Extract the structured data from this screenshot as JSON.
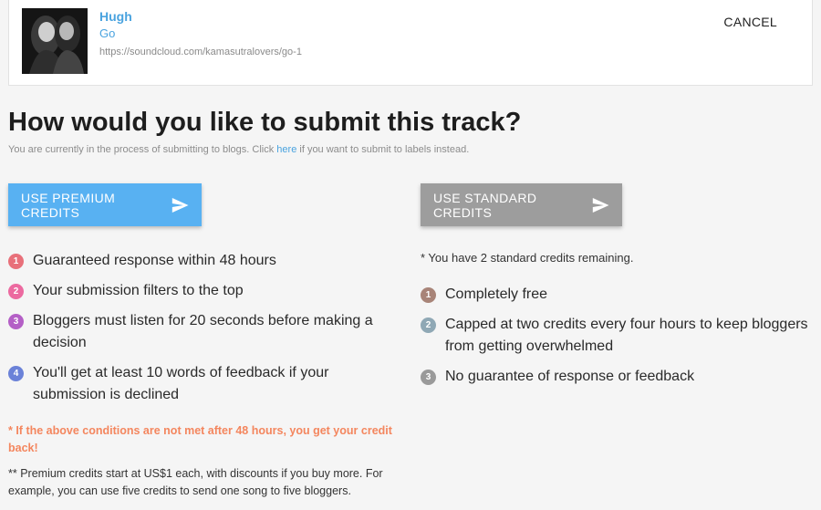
{
  "track": {
    "artist": "Hugh",
    "title": "Go",
    "url": "https://soundcloud.com/kamasutralovers/go-1",
    "cancel_label": "CANCEL"
  },
  "page": {
    "title": "How would you like to submit this track?",
    "subtitle_before": "You are currently in the process of submitting to blogs. Click ",
    "subtitle_link": "here",
    "subtitle_after": " if you want to submit to labels instead."
  },
  "premium": {
    "button_label": "USE PREMIUM CREDITS",
    "color": "#58b1f2",
    "items": [
      {
        "num": "1",
        "text": "Guaranteed response within 48 hours",
        "color": "#e8707a"
      },
      {
        "num": "2",
        "text": "Your submission filters to the top",
        "color": "#ec6aa0"
      },
      {
        "num": "3",
        "text": "Bloggers must listen for 20 seconds before making a decision",
        "color": "#b45fc6"
      },
      {
        "num": "4",
        "text": "You'll get at least 10 words of feedback if your submission is declined",
        "color": "#6b82d8"
      }
    ],
    "warning": "* If the above conditions are not met after 48 hours, you get your credit back!",
    "price_note": "** Premium credits start at US$1 each, with discounts if you buy more. For example, you can use five credits to send one song to five bloggers."
  },
  "standard": {
    "button_label": "USE STANDARD CREDITS",
    "color": "#9d9d9d",
    "remaining_note": "* You have 2 standard credits remaining.",
    "items": [
      {
        "num": "1",
        "text": "Completely free",
        "color": "#a88478"
      },
      {
        "num": "2",
        "text": "Capped at two credits every four hours to keep bloggers from getting overwhelmed",
        "color": "#8fa8b5"
      },
      {
        "num": "3",
        "text": "No guarantee of response or feedback",
        "color": "#9a9a9a"
      }
    ]
  }
}
